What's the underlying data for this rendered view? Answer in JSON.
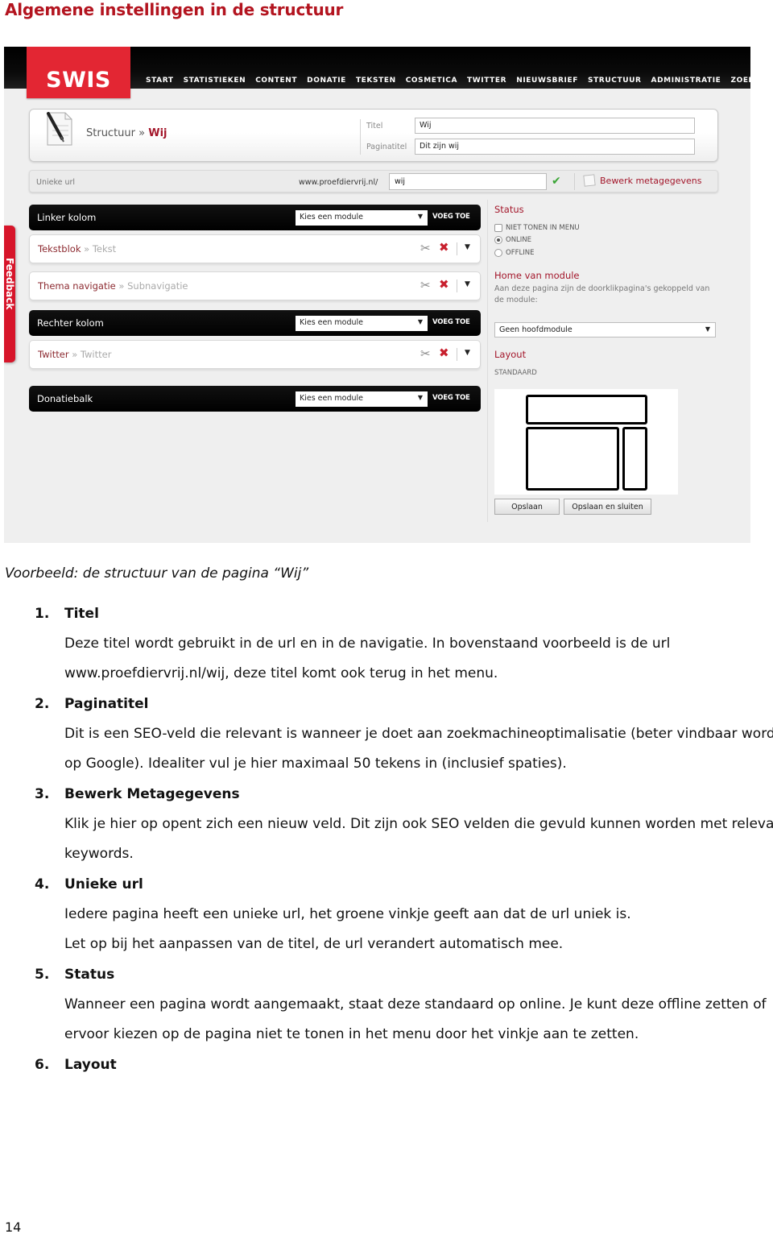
{
  "doc": {
    "title": "Algemene instellingen in de structuur",
    "caption": "Voorbeeld: de structuur van de pagina “Wij”",
    "page_number": "14",
    "items": [
      {
        "num": "1.",
        "head": "Titel",
        "lines": [
          "Deze titel wordt gebruikt in de url en in de navigatie. In bovenstaand voorbeeld is de url",
          "www.proefdiervrij.nl/wij, deze titel komt ook terug in het menu."
        ]
      },
      {
        "num": "2.",
        "head": "Paginatitel",
        "lines": [
          "Dit is een SEO-veld die relevant is wanneer je doet aan zoekmachineoptimalisatie (beter vindbaar worden",
          "op Google). Idealiter vul je hier maximaal 50 tekens in (inclusief spaties)."
        ]
      },
      {
        "num": "3.",
        "head": "Bewerk Metagegevens",
        "lines": [
          "Klik je hier op opent zich een nieuw veld. Dit zijn ook SEO velden die gevuld kunnen worden met relevante",
          "keywords."
        ]
      },
      {
        "num": "4.",
        "head": "Unieke url",
        "lines": [
          "Iedere pagina heeft een unieke url, het groene vinkje geeft aan dat de url uniek is.",
          "Let op bij het aanpassen van de titel, de url verandert automatisch mee."
        ]
      },
      {
        "num": "5.",
        "head": "Status",
        "lines": [
          "Wanneer een pagina wordt aangemaakt, staat deze standaard op online. Je kunt deze offline zetten of",
          "ervoor kiezen op de pagina niet te tonen in het menu door het vinkje aan te zetten."
        ]
      },
      {
        "num": "6.",
        "head": "Layout",
        "lines": []
      }
    ]
  },
  "cms": {
    "logo": "SWIS",
    "brand_color": "#e32633",
    "accent_color": "#a3162a",
    "nav": [
      "START",
      "STATISTIEKEN",
      "CONTENT",
      "DONATIE",
      "TEKSTEN",
      "COSMETICA",
      "TWITTER",
      "NIEUWSBRIEF",
      "STRUCTUUR",
      "ADMINISTRATIE",
      "ZOEKEN"
    ],
    "breadcrumb": {
      "parent": "Structuur",
      "separator": "»",
      "current": "Wij"
    },
    "fields": {
      "titel_label": "Titel",
      "titel_value": "Wij",
      "paginatitel_label": "Paginatitel",
      "paginatitel_value": "Dit zijn wij"
    },
    "url": {
      "label": "Unieke url",
      "base": "www.proefdiervrij.nl/",
      "value": "wij",
      "meta_link": "Bewerk metagegevens"
    },
    "feedback_tab": "Feedback",
    "sections": [
      {
        "label": "Linker kolom",
        "select": "Kies een module",
        "add": "VOEG TOE"
      },
      {
        "label": "Rechter kolom",
        "select": "Kies een module",
        "add": "VOEG TOE"
      },
      {
        "label": "Donatiebalk",
        "select": "Kies een module",
        "add": "VOEG TOE"
      }
    ],
    "modules": [
      {
        "name": "Tekstblok",
        "sub": "Tekst"
      },
      {
        "name": "Thema navigatie",
        "sub": "Subnavigatie"
      },
      {
        "name": "Twitter",
        "sub": "Twitter"
      }
    ],
    "side": {
      "status_heading": "Status",
      "opt_hide": "NIET TONEN IN MENU",
      "opt_online": "ONLINE",
      "opt_offline": "OFFLINE",
      "status_selected": "ONLINE",
      "home_heading": "Home van module",
      "home_text": "Aan deze pagina zijn de doorklikpagina's gekoppeld van de module:",
      "home_select": "Geen hoofdmodule",
      "layout_heading": "Layout",
      "layout_value": "STANDAARD",
      "save": "Opslaan",
      "save_close": "Opslaan en sluiten"
    }
  }
}
